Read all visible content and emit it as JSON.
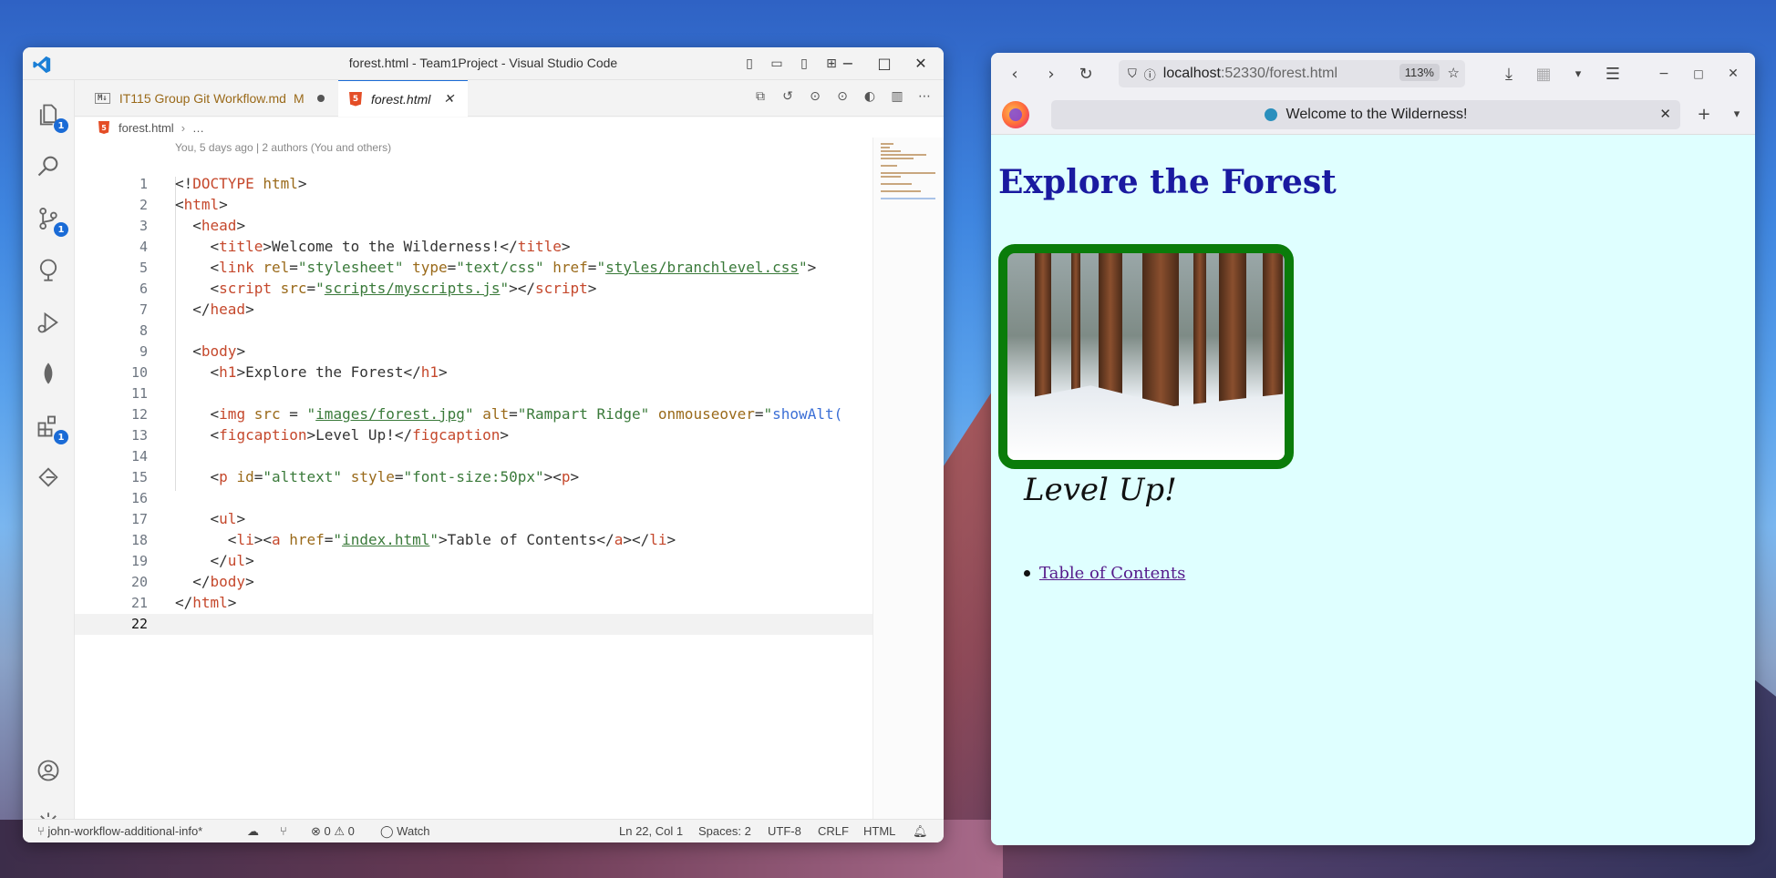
{
  "vscode": {
    "title": "forest.html - Team1Project - Visual Studio Code",
    "tabs": [
      {
        "icon": "M↓",
        "label": "IT115 Group Git Workflow.md",
        "status": "M"
      },
      {
        "icon": "5",
        "label": "forest.html"
      }
    ],
    "breadcrumb": {
      "file": "forest.html",
      "rest": "…"
    },
    "blame": "You, 5 days ago | 2 authors (You and others)",
    "badges": {
      "explorer": "1",
      "scm": "1",
      "extensions": "1"
    },
    "lines": [
      {
        "n": "1"
      },
      {
        "n": "2"
      },
      {
        "n": "3"
      },
      {
        "n": "4"
      },
      {
        "n": "5"
      },
      {
        "n": "6"
      },
      {
        "n": "7"
      },
      {
        "n": "8"
      },
      {
        "n": "9"
      },
      {
        "n": "10"
      },
      {
        "n": "11"
      },
      {
        "n": "12"
      },
      {
        "n": "13"
      },
      {
        "n": "14"
      },
      {
        "n": "15"
      },
      {
        "n": "16"
      },
      {
        "n": "17"
      },
      {
        "n": "18"
      },
      {
        "n": "19"
      },
      {
        "n": "20"
      },
      {
        "n": "21"
      },
      {
        "n": "22"
      }
    ],
    "code": {
      "l1": [
        "<!",
        "DOCTYPE",
        " ",
        "html",
        ">"
      ],
      "l2": [
        "<",
        "html",
        ">"
      ],
      "l3": [
        "  <",
        "head",
        ">"
      ],
      "l4": [
        "    <",
        "title",
        ">Welcome to the Wilderness!</",
        "title",
        ">"
      ],
      "l5": [
        "    <",
        "link",
        " ",
        "rel",
        "=",
        "\"stylesheet\"",
        " ",
        "type",
        "=",
        "\"text/css\"",
        " ",
        "href",
        "=",
        "\"",
        "styles/branchlevel.css",
        "\"",
        ">"
      ],
      "l6": [
        "    <",
        "script",
        " ",
        "src",
        "=",
        "\"",
        "scripts/myscripts.js",
        "\"",
        "></",
        "script",
        ">"
      ],
      "l7": [
        "  </",
        "head",
        ">"
      ],
      "l9": [
        "  <",
        "body",
        ">"
      ],
      "l10": [
        "    <",
        "h1",
        ">Explore the Forest</",
        "h1",
        ">"
      ],
      "l12": [
        "    <",
        "img",
        " ",
        "src",
        " = ",
        "\"",
        "images/forest.jpg",
        "\"",
        " ",
        "alt",
        "=",
        "\"Rampart Ridge\"",
        " ",
        "onmouseover",
        "=",
        "\"",
        "showAlt("
      ],
      "l13": [
        "    <",
        "figcaption",
        ">Level Up!</",
        "figcaption",
        ">"
      ],
      "l15": [
        "    <",
        "p",
        " ",
        "id",
        "=",
        "\"alttext\"",
        " ",
        "style",
        "=",
        "\"font-size:50px\"",
        "><",
        "p",
        ">"
      ],
      "l17": [
        "    <",
        "ul",
        ">"
      ],
      "l18": [
        "      <",
        "li",
        "><",
        "a",
        " ",
        "href",
        "=",
        "\"",
        "index.html",
        "\"",
        ">Table of Contents</",
        "a",
        "></",
        "li",
        ">"
      ],
      "l19": [
        "    </",
        "ul",
        ">"
      ],
      "l20": [
        "  </",
        "body",
        ">"
      ],
      "l21": [
        "</",
        "html",
        ">"
      ]
    },
    "status": {
      "branch": "john-workflow-additional-info*",
      "problems": "0",
      "warnings": "0",
      "watch": "Watch",
      "position": "Ln 22, Col 1",
      "spaces": "Spaces: 2",
      "encoding": "UTF-8",
      "eol": "CRLF",
      "language": "HTML"
    }
  },
  "firefox": {
    "url_host": "localhost",
    "url_rest": ":52330/forest.html",
    "zoom": "113%",
    "tab_title": "Welcome to the Wilderness!",
    "page": {
      "heading": "Explore the Forest",
      "figcaption": "Level Up!",
      "links": [
        "Table of Contents"
      ]
    }
  }
}
